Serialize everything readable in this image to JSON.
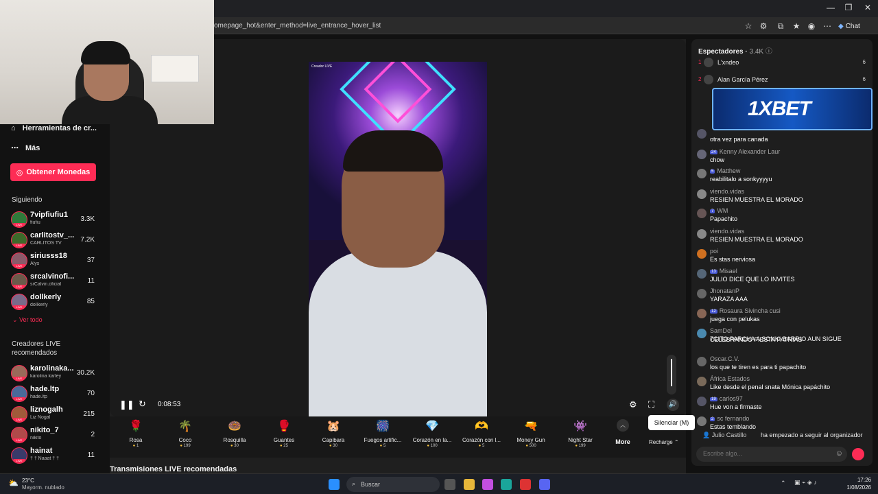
{
  "browser": {
    "url": "omepage_hot&enter_method=live_entrance_hover_list",
    "chat_label": "Chat"
  },
  "sidebar": {
    "tools_label": "Herramientas de cr...",
    "more_label": "Más",
    "coins_button": "Obtener Monedas",
    "following_title": "Siguiendo",
    "following": [
      {
        "name": "7vipfiufiu1",
        "sub": "fiufiu",
        "count": "3.3K",
        "color": "#2f7a3a"
      },
      {
        "name": "carlitostv_...",
        "sub": "CARLITOS TV",
        "count": "7.2K",
        "color": "#3c6a2a"
      },
      {
        "name": "siriusss18",
        "sub": "Alys",
        "count": "37",
        "color": "#8a5a6a"
      },
      {
        "name": "srcalvinofi...",
        "sub": "srCalvin.oficial",
        "count": "11",
        "color": "#6a5a4a"
      },
      {
        "name": "dollkerly",
        "sub": "dollkerly",
        "count": "85",
        "color": "#7a6a8a"
      }
    ],
    "see_all": "Ver todo",
    "recommended_title_1": "Creadores LIVE",
    "recommended_title_2": "recomendados",
    "recommended": [
      {
        "name": "karolinaka...",
        "sub": "karolina karley",
        "count": "30.2K",
        "color": "#9a6a5a"
      },
      {
        "name": "hade.ltp",
        "sub": "hade.ltp",
        "count": "70",
        "color": "#4a6a9a"
      },
      {
        "name": "liznogalh",
        "sub": "Liz Nogal",
        "count": "215",
        "color": "#a05a3a"
      },
      {
        "name": "nikito_7",
        "sub": "nikito",
        "count": "2",
        "color": "#b04a4a"
      },
      {
        "name": "hainat",
        "sub": "† † Naaat † †",
        "count": "11",
        "color": "#3a3a6a"
      }
    ]
  },
  "player": {
    "video_tag": "Creador LIVE",
    "time": "0:08:53",
    "tooltip": "Silenciar (M)",
    "recharge": "Recharge",
    "more": "More",
    "volume_level": 0.9
  },
  "gifts": [
    {
      "name": "Rosa",
      "price": "1",
      "icon": "🌹"
    },
    {
      "name": "Coco",
      "price": "199",
      "icon": "🌴"
    },
    {
      "name": "Rosquilla",
      "price": "30",
      "icon": "🍩"
    },
    {
      "name": "Guantes",
      "price": "25",
      "icon": "🥊"
    },
    {
      "name": "Capibara",
      "price": "30",
      "icon": "🐹"
    },
    {
      "name": "Fuegos artific...",
      "price": "5",
      "icon": "🎆"
    },
    {
      "name": "Corazón en la...",
      "price": "100",
      "icon": "💎"
    },
    {
      "name": "Corazón con l...",
      "price": "5",
      "icon": "🫶"
    },
    {
      "name": "Money Gun",
      "price": "500",
      "icon": "🔫"
    },
    {
      "name": "Night Star",
      "price": "199",
      "icon": "👾"
    }
  ],
  "recommended_streams": "Transmisiones LIVE recomendadas",
  "chat": {
    "viewers_label": "Espectadores",
    "viewers_count": "3.4K",
    "ranking": [
      {
        "rank": "1",
        "name": "L'xndeo",
        "count": "6"
      },
      {
        "rank": "2",
        "name": "Alan García Pérez",
        "count": "6"
      }
    ],
    "ad_text": "1XBET",
    "messages": [
      {
        "name": "",
        "badge": "",
        "text": "otra vez para canada"
      },
      {
        "name": "Kenny Alexander Laur",
        "badge": "24",
        "text": "chow"
      },
      {
        "name": "Matthew",
        "badge": "5",
        "text": "reabilitalo a sonkyyyyu"
      },
      {
        "name": "viendo.vidas",
        "badge": "",
        "text": "RESIEN MUESTRA EL MORADO"
      },
      {
        "name": "WM",
        "badge": "7",
        "text": "Papachito"
      },
      {
        "name": "viendo.vidas",
        "badge": "",
        "text": "RESIEN MUESTRA EL MORADO"
      },
      {
        "name": "poi",
        "badge": "",
        "text": "Es stas nerviosa"
      },
      {
        "name": "Misael",
        "badge": "13",
        "text": "JULIO DICE QUE LO INVITES"
      },
      {
        "name": "JhonatanP",
        "badge": "",
        "text": "YARAZA AAA"
      },
      {
        "name": "Rosaura Sivincha cusi",
        "badge": "12",
        "text": "juega con pelukas"
      },
      {
        "name": "SamDel",
        "badge": "",
        "text": "7CITO PARCHA A SONKI BARRIO AUN SIGUE"
      },
      {
        "name": "",
        "badge": "",
        "text": "CELEBRANDO FIESTA PATRIAS"
      },
      {
        "name": "Oscar.C.V.",
        "badge": "",
        "text": "los que te tiren es para ti papachito"
      },
      {
        "name": "África Estados",
        "badge": "",
        "text": "Like desde el penal snata Mónica papáchito"
      },
      {
        "name": "carlos97",
        "badge": "19",
        "text": "Hue von a firmaste"
      },
      {
        "name": "sc fernando",
        "badge": "2",
        "text": "Estas temblando"
      }
    ],
    "follow_notice": "Julio Castillo",
    "follow_text": "ha empezado a seguir al organizador",
    "input_placeholder": "Escribe algo..."
  },
  "taskbar": {
    "weather_temp": "23°C",
    "weather_desc": "Mayorm. nublado",
    "search_label": "Buscar",
    "time": "17:26",
    "date": "1/08/2026"
  }
}
